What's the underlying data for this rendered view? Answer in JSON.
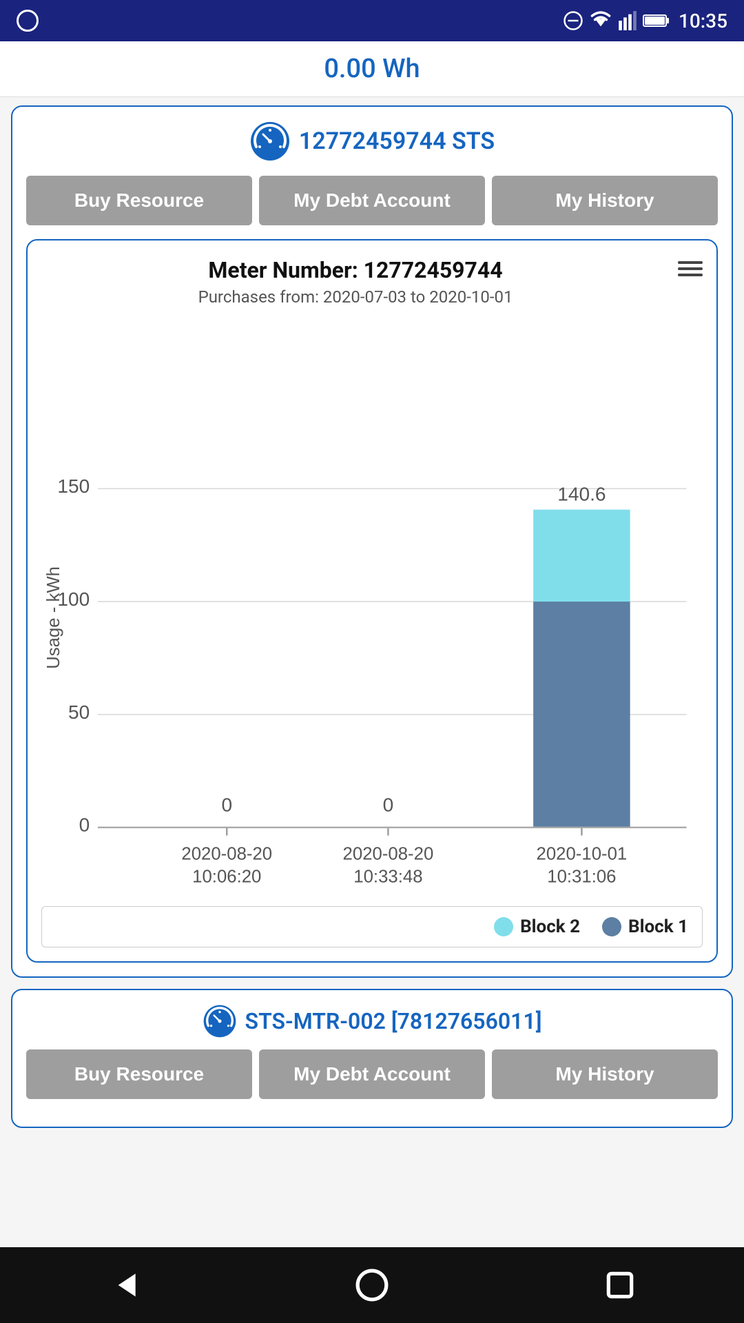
{
  "statusBar": {
    "time": "10:35"
  },
  "energyBar": {
    "value": "0.00 Wh"
  },
  "meter1": {
    "id": "12772459744 STS",
    "buttons": {
      "buy": "Buy Resource",
      "debt": "My Debt Account",
      "history": "My History"
    },
    "chart": {
      "title": "Meter Number: 12772459744",
      "subtitle": "Purchases from: 2020-07-03 to 2020-10-01",
      "yAxisLabel": "Usage - kWh",
      "yMax": 150,
      "yMid": 100,
      "yLow": 50,
      "yMin": 0,
      "bars": [
        {
          "date": "2020-08-20",
          "time": "10:06:20",
          "block1": 0,
          "block2": 0,
          "label": "0"
        },
        {
          "date": "2020-08-20",
          "time": "10:33:48",
          "block1": 0,
          "block2": 0,
          "label": "0"
        },
        {
          "date": "2020-10-01",
          "time": "10:31:06",
          "block1": 100,
          "block2": 40.6,
          "totalLabel": "140.6"
        }
      ],
      "legend": {
        "block2": "Block 2",
        "block1": "Block 1"
      }
    }
  },
  "meter2": {
    "id": "STS-MTR-002 [78127656011]"
  },
  "buttons": {
    "buy2": "Buy Resource",
    "debt2": "My Debt Account",
    "history2": "My History"
  }
}
